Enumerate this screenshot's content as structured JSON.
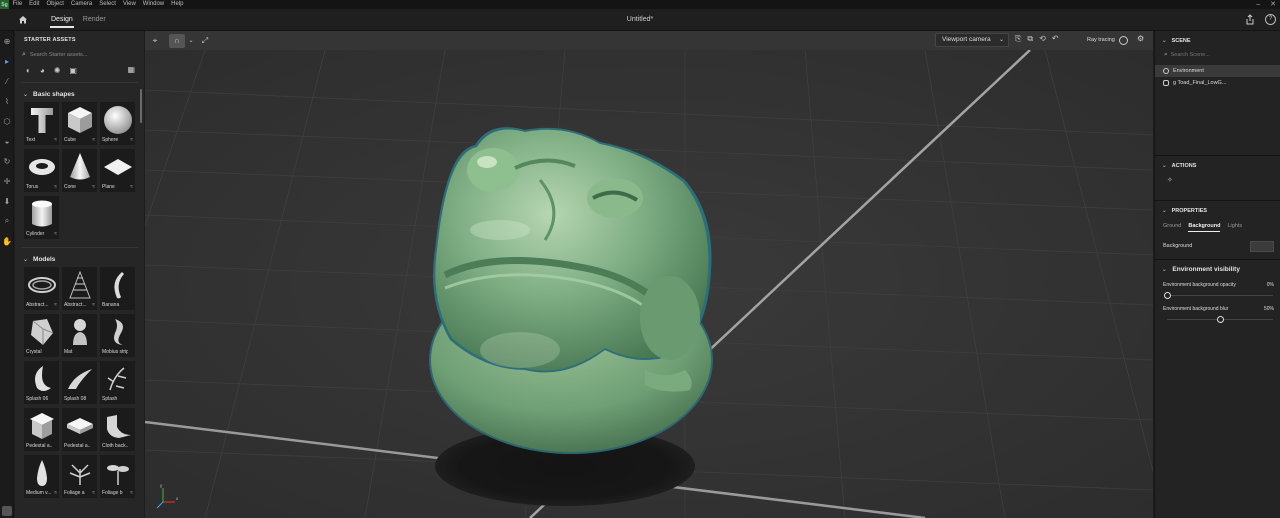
{
  "app": {
    "logo": "Sg",
    "menu": [
      "File",
      "Edit",
      "Object",
      "Camera",
      "Select",
      "View",
      "Window",
      "Help"
    ],
    "window_controls": [
      "–",
      "✕"
    ]
  },
  "tabs": [
    {
      "label": "Design",
      "active": true
    },
    {
      "label": "Render",
      "active": false
    }
  ],
  "document_title": "Untitled*",
  "left_panel": {
    "title": "STARTER ASSETS",
    "search_placeholder": "Search Starter assets...",
    "sections": [
      {
        "title": "Basic shapes",
        "items": [
          "Text",
          "Cube",
          "Sphere",
          "Torus",
          "Cone",
          "Plane",
          "Cylinder"
        ]
      },
      {
        "title": "Models",
        "items": [
          "Abstract...",
          "Abstract...",
          "Banana",
          "Crystal",
          "Mat",
          "Mobius strip",
          "Splash 06",
          "Splash 08",
          "Splash",
          "Pedestal a...",
          "Pedestal a...",
          "Cloth back...",
          "Medium v...",
          "Foliage a",
          "Foliage b"
        ]
      }
    ],
    "option_glyph": "≈"
  },
  "viewport": {
    "camera_select": "Viewport camera",
    "ray_tracing_label": "Ray tracing",
    "axis_x_label": "x",
    "axis_y_label": "y"
  },
  "right_panel": {
    "scene_title": "SCENE",
    "scene_search_placeholder": "Search Scene...",
    "scene_items": [
      {
        "label": "Environment",
        "selected": true
      },
      {
        "label": "g Toad_Final_LowG...",
        "selected": false
      }
    ],
    "actions_title": "ACTIONS",
    "properties_title": "PROPERTIES",
    "property_tabs": [
      {
        "label": "Ground",
        "active": false
      },
      {
        "label": "Background",
        "active": true
      },
      {
        "label": "Lights",
        "active": false
      }
    ],
    "background_label": "Background",
    "env_visibility_title": "Environment visibility",
    "sliders": [
      {
        "label": "Environment background opacity",
        "value_text": "0%",
        "value": 0
      },
      {
        "label": "Environment background blur",
        "value_text": "50%",
        "value": 50
      }
    ]
  },
  "colors": {
    "accent": "#4aa3ff",
    "viewport_bg": "#353535",
    "panel_bg": "#262626",
    "toad_green": "#6fa07a"
  }
}
